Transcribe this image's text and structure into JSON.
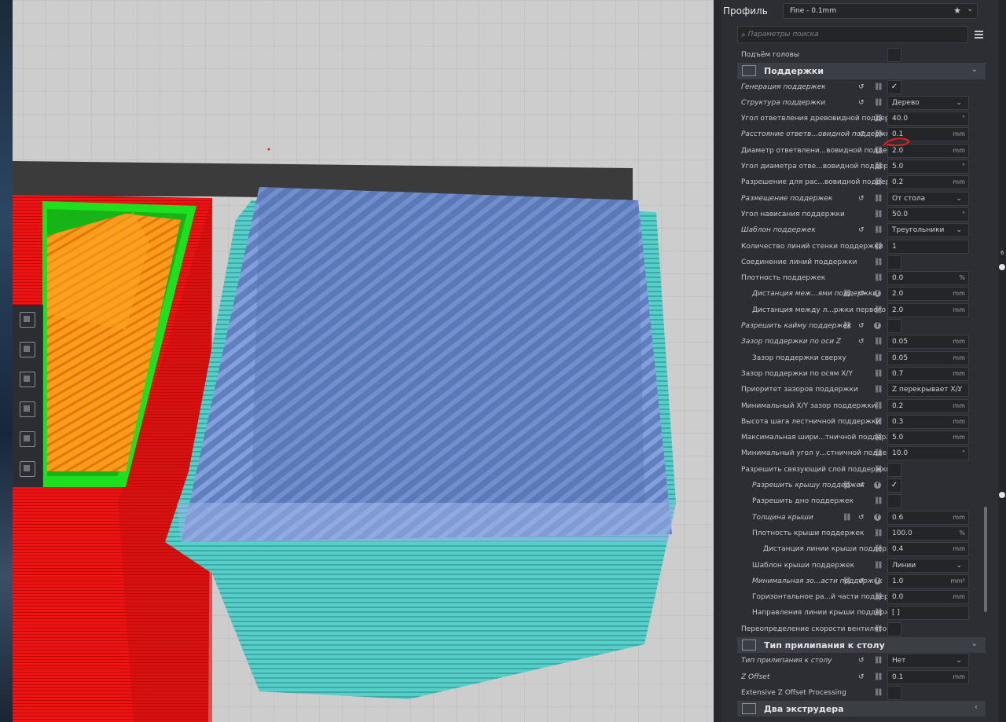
{
  "profile": {
    "label": "Профиль",
    "value": "Fine - 0.1mm"
  },
  "search": {
    "placeholder": "Параметры поиска"
  },
  "top_row": {
    "name": "Подъём головы"
  },
  "category_support": {
    "title": "Поддержки"
  },
  "settings": [
    {
      "name": "Генерация поддержек",
      "italic": true,
      "control": "check",
      "checked": true
    },
    {
      "name": "Структура поддержки",
      "italic": true,
      "control": "dropdown",
      "value": "Дерево"
    },
    {
      "name": "Угол ответвления древовидной поддержки",
      "control": "value",
      "value": "40.0",
      "unit": "°"
    },
    {
      "name": "Расстояние ответв...овидной поддержки",
      "italic": true,
      "control": "value",
      "value": "0.1",
      "unit": "mm"
    },
    {
      "name": "Диаметр ответвлени...вовидной поддержки",
      "control": "value",
      "value": "2.0",
      "unit": "mm"
    },
    {
      "name": "Угол диаметра отве...вовидной поддержки",
      "control": "value",
      "value": "5.0",
      "unit": "°"
    },
    {
      "name": "Разрешение для рас...вовидной поддержки",
      "control": "value",
      "value": "0.2",
      "unit": "mm"
    },
    {
      "name": "Размещение поддержек",
      "italic": true,
      "control": "dropdown",
      "value": "От стола"
    },
    {
      "name": "Угол нависания поддержки",
      "control": "value",
      "value": "50.0",
      "unit": "°"
    },
    {
      "name": "Шаблон поддержек",
      "italic": true,
      "control": "dropdown",
      "value": "Треугольники"
    },
    {
      "name": "Количество линий стенки поддержки",
      "control": "value",
      "value": "1",
      "unit": ""
    },
    {
      "name": "Соединение линий поддержки",
      "control": "check",
      "checked": false
    },
    {
      "name": "Плотность поддержек",
      "control": "value",
      "value": "0.0",
      "unit": "%"
    },
    {
      "name": "Дистанция меж...ями поддержки",
      "italic": true,
      "indent": 1,
      "f": true,
      "control": "value",
      "value": "2.0",
      "unit": "mm"
    },
    {
      "name": "Дистанция между л...ржки первого слоя",
      "indent": 1,
      "control": "value",
      "value": "2.0",
      "unit": "mm"
    },
    {
      "name": "Разрешить кайму поддержек",
      "italic": true,
      "f": true,
      "control": "check",
      "checked": false
    },
    {
      "name": "Зазор поддержки по оси Z",
      "italic": true,
      "control": "value",
      "value": "0.05",
      "unit": "mm"
    },
    {
      "name": "Зазор поддержки сверху",
      "indent": 1,
      "control": "value",
      "value": "0.05",
      "unit": "mm"
    },
    {
      "name": "Зазор поддержки по осям X/Y",
      "control": "value",
      "value": "0.7",
      "unit": "mm"
    },
    {
      "name": "Приоритет зазоров поддержки",
      "control": "dropdown",
      "value": "Z перекрывает X/Y"
    },
    {
      "name": "Минимальный X/Y зазор поддержки",
      "control": "value",
      "value": "0.2",
      "unit": "mm"
    },
    {
      "name": "Высота шага лестничной поддержки",
      "control": "value",
      "value": "0.3",
      "unit": "mm"
    },
    {
      "name": "Максимальная шири...тничной поддержки",
      "control": "value",
      "value": "5.0",
      "unit": "mm"
    },
    {
      "name": "Минимальный угол у...стничной поддержки",
      "control": "value",
      "value": "10.0",
      "unit": "°"
    },
    {
      "name": "Разрешить связующий слой поддержки",
      "control": "check",
      "checked": false
    },
    {
      "name": "Разрешить крышу поддержек",
      "italic": true,
      "indent": 1,
      "f": true,
      "control": "check",
      "checked": true
    },
    {
      "name": "Разрешить дно поддержек",
      "indent": 1,
      "control": "check",
      "checked": false
    },
    {
      "name": "Толщина крыши",
      "italic": true,
      "indent": 1,
      "f": true,
      "control": "value",
      "value": "0.6",
      "unit": "mm"
    },
    {
      "name": "Плотность крыши поддержек",
      "indent": 1,
      "control": "value",
      "value": "100.0",
      "unit": "%"
    },
    {
      "name": "Дистанция линии крыши поддержек",
      "indent": 2,
      "control": "value",
      "value": "0.4",
      "unit": "mm"
    },
    {
      "name": "Шаблон крыши поддержек",
      "indent": 1,
      "control": "dropdown",
      "value": "Линии"
    },
    {
      "name": "Минимальная зо...асти поддержек",
      "italic": true,
      "indent": 1,
      "f": true,
      "control": "value",
      "value": "1.0",
      "unit": "mm²"
    },
    {
      "name": "Горизонтальное ра...й части поддержек",
      "indent": 1,
      "control": "value",
      "value": "0.0",
      "unit": "mm"
    },
    {
      "name": "Направления линии крыши поддержек",
      "indent": 1,
      "control": "value",
      "value": "[ ]",
      "unit": ""
    },
    {
      "name": "Переопределение скорости вентилятора",
      "control": "check",
      "checked": false
    }
  ],
  "category_adhesion": {
    "title": "Тип прилипания к столу"
  },
  "adhesion_settings": [
    {
      "name": "Тип прилипания к столу",
      "italic": true,
      "control": "dropdown",
      "value": "Нет"
    },
    {
      "name": "Z Offset",
      "italic": true,
      "control": "value",
      "value": "0.1",
      "unit": "mm"
    },
    {
      "name": "Extensive Z Offset Processing",
      "control": "check",
      "checked": false
    }
  ],
  "category_dual": {
    "title": "Два экструдера"
  },
  "right_strip": {
    "number": "6"
  },
  "colors": {
    "red_part": "#ff1a1a",
    "green_part": "#22ee22",
    "orange_part": "#ff9a1a",
    "support_blue": "#7f9ad8",
    "support_cyan": "#5fd4cf",
    "build_plate": "#c8c8c8"
  }
}
